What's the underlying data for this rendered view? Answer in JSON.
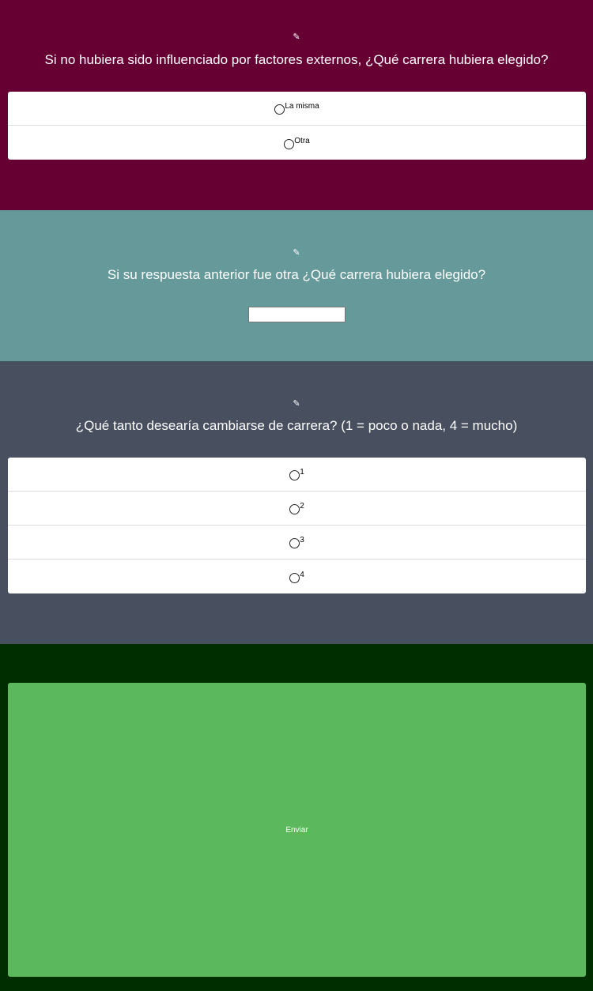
{
  "q1": {
    "icon": "pen-icon",
    "text": "Si no hubiera sido influenciado por factores externos, ¿Qué carrera hubiera elegido?",
    "options": [
      "La misma",
      "Otra"
    ]
  },
  "q2": {
    "icon": "pen-icon",
    "text": "Si su respuesta anterior fue otra ¿Qué carrera hubiera elegido?",
    "input_value": ""
  },
  "q3": {
    "icon": "pen-icon",
    "text": "¿Qué tanto desearía cambiarse de carrera? (1 = poco o nada, 4 = mucho)",
    "options": [
      "1",
      "2",
      "3",
      "4"
    ]
  },
  "submit": {
    "label": "Enviar"
  },
  "colors": {
    "section1_bg": "#660033",
    "section2_bg": "#669999",
    "section3_bg": "#484f5f",
    "section4_bg": "#002e00",
    "submit_bg": "#5cb85c"
  }
}
